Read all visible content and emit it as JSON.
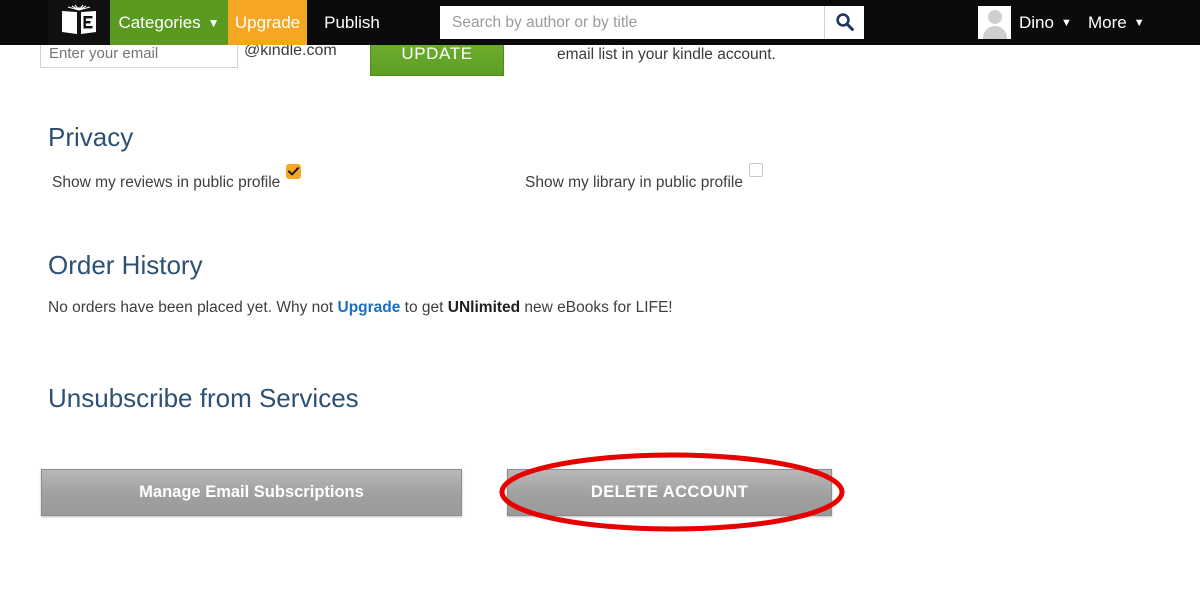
{
  "topbar": {
    "logo_icon": "open-book-logo-icon",
    "nav": [
      {
        "label": "Categories",
        "caret": "▼",
        "icon": "chevron-down-icon"
      },
      {
        "label": "Upgrade"
      },
      {
        "label": "Publish"
      }
    ],
    "search": {
      "placeholder": "Search by author or by title",
      "value": "",
      "icon": "search-icon"
    },
    "avatar_icon": "avatar-placeholder-icon",
    "user_menu": {
      "label": "Dino",
      "caret": "▼",
      "icon": "chevron-down-icon"
    },
    "more_menu": {
      "label": "More",
      "caret": "▼",
      "icon": "chevron-down-icon"
    }
  },
  "kindle_row": {
    "email_placeholder": "Enter your email",
    "email_value": "",
    "domain_label": "@kindle.com",
    "update_label": "UPDATE",
    "note": "email list in your kindle account."
  },
  "privacy": {
    "heading": "Privacy",
    "reviews_label": "Show my reviews in public profile",
    "reviews_checked": true,
    "library_label": "Show my library in public profile",
    "library_checked": false
  },
  "order_history": {
    "heading": "Order History",
    "text_before": "No orders have been placed yet. Why not ",
    "link_label": "Upgrade",
    "text_middle": " to get ",
    "bold_label": "UNlimited",
    "text_after": " new eBooks for LIFE!"
  },
  "unsubscribe": {
    "heading": "Unsubscribe from Services",
    "manage_label": "Manage Email Subscriptions",
    "delete_label": "DELETE ACCOUNT"
  },
  "annotation": {
    "shape": "ellipse-highlight",
    "color": "#e60000",
    "target": "delete-account-button"
  },
  "colors": {
    "nav_green": "#5a9a20",
    "nav_orange": "#f5a623",
    "heading_blue": "#2d5075",
    "link_blue": "#1a6fc4",
    "annotation_red": "#e60000"
  }
}
